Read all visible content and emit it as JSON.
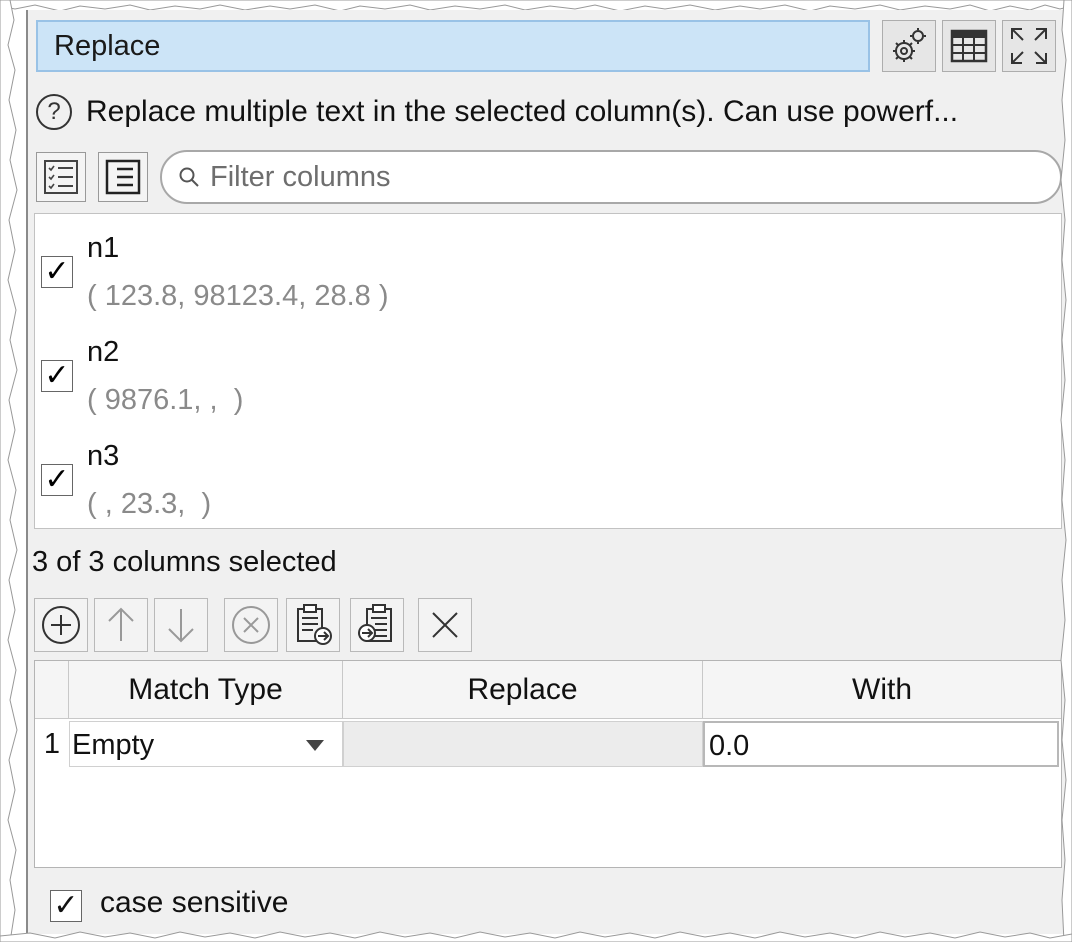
{
  "panel": {
    "title": "Replace",
    "description": "Replace multiple text in the selected column(s). Can use powerf...",
    "filter_placeholder": "Filter columns",
    "columns": [
      {
        "name": "n1",
        "values": "( 123.8, 98123.4, 28.8 )",
        "checked": true
      },
      {
        "name": "n2",
        "values": "( 9876.1, ,  )",
        "checked": true
      },
      {
        "name": "n3",
        "values": "( , 23.3,  )",
        "checked": true
      }
    ],
    "selected_count": "3 of 3 columns selected",
    "table": {
      "headers": [
        "Match Type",
        "Replace",
        "With"
      ],
      "rows": [
        {
          "index": "1",
          "match_type": "Empty",
          "replace": "",
          "with": "0.0"
        }
      ]
    },
    "case_sensitive_label": "case sensitive",
    "case_sensitive_checked": true
  },
  "colors": {
    "title_bg": "#cce4f7",
    "title_border": "#99c2e6",
    "panel_bg": "#f0f0f0"
  }
}
